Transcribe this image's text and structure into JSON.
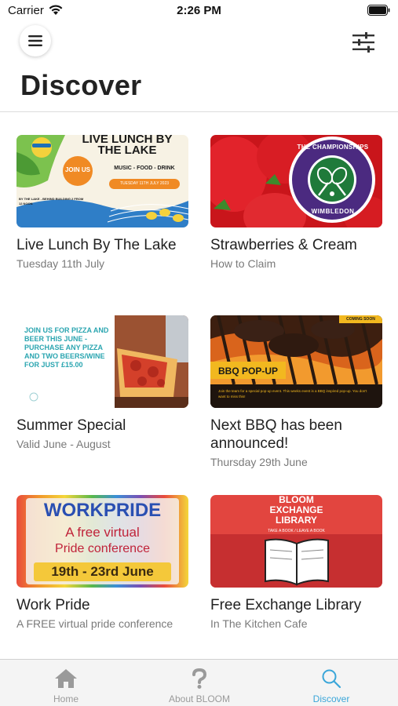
{
  "status_bar": {
    "carrier": "Carrier",
    "time": "2:26 PM"
  },
  "header": {
    "title": "Discover",
    "menu_icon": "hamburger-menu-icon",
    "filter_icon": "sliders-filter-icon"
  },
  "cards": [
    {
      "title": "Live Lunch By The Lake",
      "subtitle": "Tuesday 11th July",
      "image": {
        "heading": "LIVE LUNCH BY THE LAKE",
        "badge": "JOIN US",
        "tagline": "MUSIC - FOOD - DRINK",
        "date": "TUESDAY 11TH JULY 2023",
        "location": "BY THE LAKE - BEHIND BUILDING 2 FROM 12 NOON"
      }
    },
    {
      "title": "Strawberries & Cream",
      "subtitle": "How to Claim",
      "image": {
        "seal_top": "THE CHAMPIONSHIPS",
        "seal_bottom": "WIMBLEDON"
      }
    },
    {
      "title": "Summer Special",
      "subtitle": "Valid June - August",
      "image": {
        "promo": "JOIN US FOR PIZZA AND BEER THIS JUNE - PURCHASE ANY PIZZA AND TWO BEERS/WINE FOR JUST £15.00"
      }
    },
    {
      "title": "Next BBQ has been announced!",
      "subtitle": "Thursday 29th June",
      "image": {
        "banner": "BBQ POP-UP",
        "corner": "COMING SOON",
        "caption": "Join the team for a special pop-up event. This weeks event is a BBQ inspired pop-up. You don't want to miss this!"
      }
    },
    {
      "title": "Work Pride",
      "subtitle": "A FREE virtual pride conference",
      "image": {
        "heading": "WORKPRIDE",
        "line1": "A free virtual",
        "line2": "Pride conference",
        "dates": "19th - 23rd June"
      }
    },
    {
      "title": "Free Exchange Library",
      "subtitle": "In The Kitchen Cafe",
      "image": {
        "heading_line1": "BLOOM",
        "heading_line2": "EXCHANGE",
        "heading_line3": "LIBRARY",
        "tagline": "TAKE A BOOK / LEAVE A BOOK"
      }
    }
  ],
  "tab_bar": {
    "tabs": [
      {
        "label": "Home",
        "icon": "home-icon",
        "active": false
      },
      {
        "label": "About BLOOM",
        "icon": "question-mark-icon",
        "active": false
      },
      {
        "label": "Discover",
        "icon": "search-icon",
        "active": true
      }
    ]
  },
  "colors": {
    "accent": "#3aa6d9",
    "inactive": "#9a9a9a"
  }
}
